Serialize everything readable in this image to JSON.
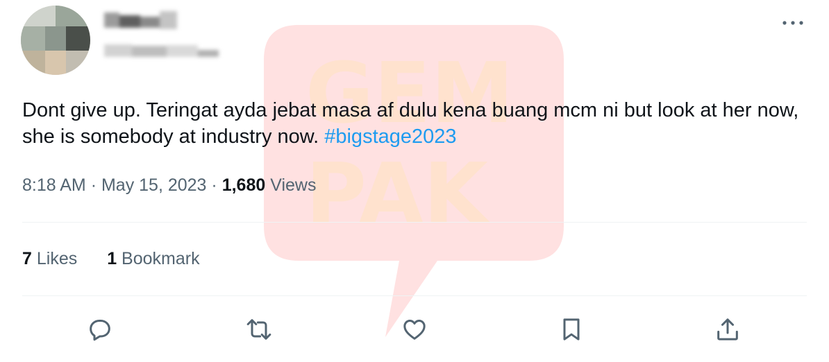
{
  "header": {
    "more_icon": "more-horizontal-icon"
  },
  "tweet": {
    "text": "Dont give up. Teringat ayda jebat masa af dulu kena buang mcm ni but look at her now, she is somebody at industry now. ",
    "hashtag": "#bigstage2023",
    "hashtag_color": "#1d9bf0"
  },
  "meta": {
    "time": "8:18 AM",
    "separator": "·",
    "date": "May 15, 2023",
    "views_count": "1,680",
    "views_label": "Views"
  },
  "stats": {
    "likes_count": "7",
    "likes_label": "Likes",
    "bookmarks_count": "1",
    "bookmarks_label": "Bookmark"
  },
  "actions": [
    {
      "icon": "reply-icon"
    },
    {
      "icon": "retweet-icon"
    },
    {
      "icon": "like-icon"
    },
    {
      "icon": "bookmark-icon"
    },
    {
      "icon": "share-icon"
    }
  ],
  "watermark": {
    "text_line1": "GEM",
    "text_line2": "PAK",
    "color": "#ff4d4d"
  }
}
